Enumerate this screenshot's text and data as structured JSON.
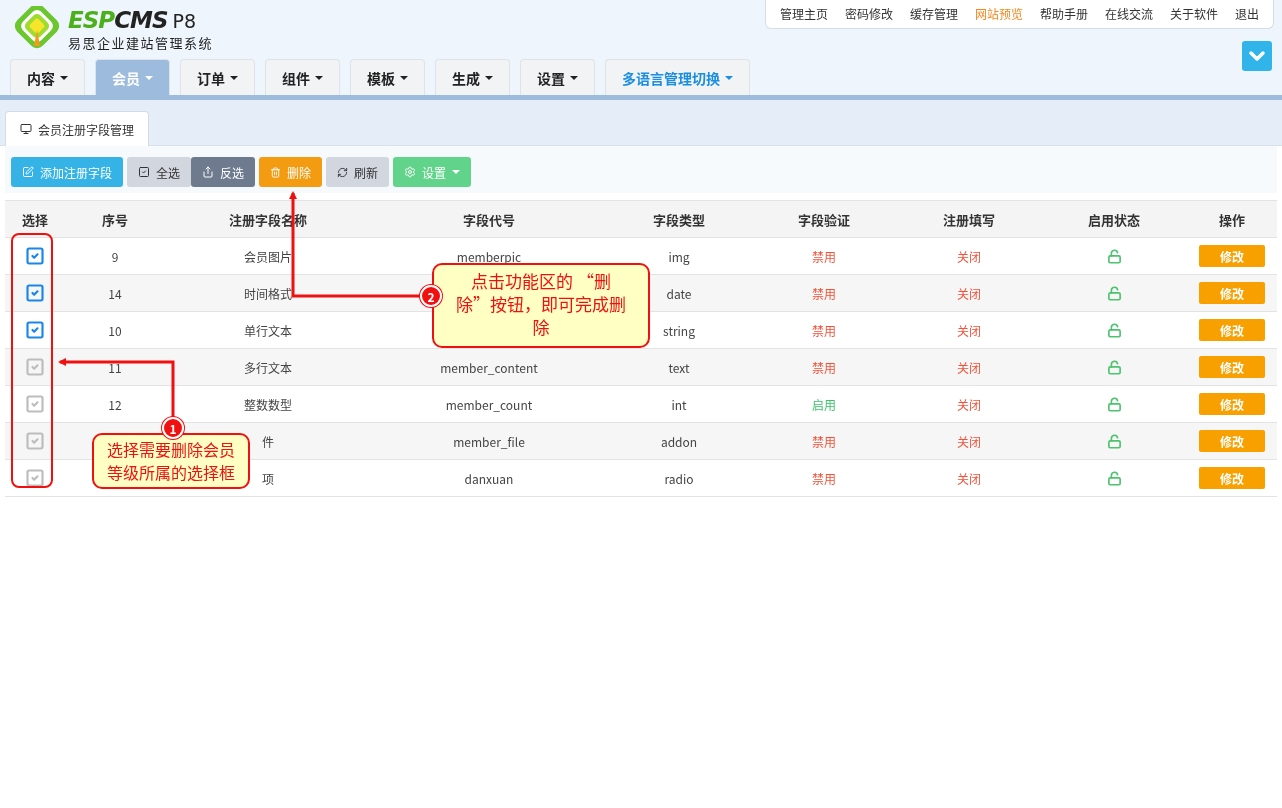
{
  "logo": {
    "brand_a": "ESP",
    "brand_b": "CMS",
    "version": "P8",
    "subtitle": "易思企业建站管理系统"
  },
  "top_links": [
    {
      "label": "管理主页",
      "highlight": false
    },
    {
      "label": "密码修改",
      "highlight": false
    },
    {
      "label": "缓存管理",
      "highlight": false
    },
    {
      "label": "网站预览",
      "highlight": true
    },
    {
      "label": "帮助手册",
      "highlight": false
    },
    {
      "label": "在线交流",
      "highlight": false
    },
    {
      "label": "关于软件",
      "highlight": false
    },
    {
      "label": "退出",
      "highlight": false
    }
  ],
  "nav_tabs": [
    {
      "label": "内容",
      "selected": false,
      "accent": false
    },
    {
      "label": "会员",
      "selected": true,
      "accent": false
    },
    {
      "label": "订单",
      "selected": false,
      "accent": false
    },
    {
      "label": "组件",
      "selected": false,
      "accent": false
    },
    {
      "label": "模板",
      "selected": false,
      "accent": false
    },
    {
      "label": "生成",
      "selected": false,
      "accent": false
    },
    {
      "label": "设置",
      "selected": false,
      "accent": false
    },
    {
      "label": "多语言管理切换",
      "selected": false,
      "accent": true
    }
  ],
  "page_tab": {
    "label": "会员注册字段管理"
  },
  "toolbar": [
    {
      "label": "添加注册字段",
      "kind": "add"
    },
    {
      "label": "全选",
      "kind": "select_all"
    },
    {
      "label": "反选",
      "kind": "invert"
    },
    {
      "label": "删除",
      "kind": "delete"
    },
    {
      "label": "刷新",
      "kind": "refresh"
    },
    {
      "label": "设置",
      "kind": "settings"
    }
  ],
  "table": {
    "columns": [
      "选择",
      "序号",
      "注册字段名称",
      "字段代号",
      "字段类型",
      "字段验证",
      "注册填写",
      "启用状态",
      "操作"
    ],
    "rows": [
      {
        "checked": true,
        "number": "9",
        "name": "会员图片",
        "code": "memberpic",
        "type": "img",
        "validation": "禁用",
        "validation_on": false,
        "required": "关闭",
        "action": "修改"
      },
      {
        "checked": true,
        "number": "14",
        "name": "时间格式",
        "type": "date",
        "validation": "禁用",
        "validation_on": false,
        "required": "关闭",
        "action": "修改"
      },
      {
        "checked": true,
        "number": "10",
        "name": "单行文本",
        "type": "string",
        "validation": "禁用",
        "validation_on": false,
        "required": "关闭",
        "action": "修改"
      },
      {
        "checked": false,
        "number": "11",
        "name": "多行文本",
        "code": "member_content",
        "type": "text",
        "validation": "禁用",
        "validation_on": false,
        "required": "关闭",
        "action": "修改"
      },
      {
        "checked": false,
        "number": "12",
        "name": "整数数型",
        "code": "member_count",
        "type": "int",
        "validation": "启用",
        "validation_on": true,
        "required": "关闭",
        "action": "修改"
      },
      {
        "checked": false,
        "name": "件",
        "code": "member_file",
        "type": "addon",
        "validation": "禁用",
        "validation_on": false,
        "required": "关闭",
        "action": "修改"
      },
      {
        "checked": false,
        "name": "项",
        "code": "danxuan",
        "type": "radio",
        "validation": "禁用",
        "validation_on": false,
        "required": "关闭",
        "action": "修改"
      }
    ]
  },
  "callouts": [
    {
      "badge": "1",
      "text": "选择需要删除会员等级所属的选择框"
    },
    {
      "badge": "2",
      "text": "点击功能区的 “删除”按钮，即可完成删除"
    }
  ]
}
